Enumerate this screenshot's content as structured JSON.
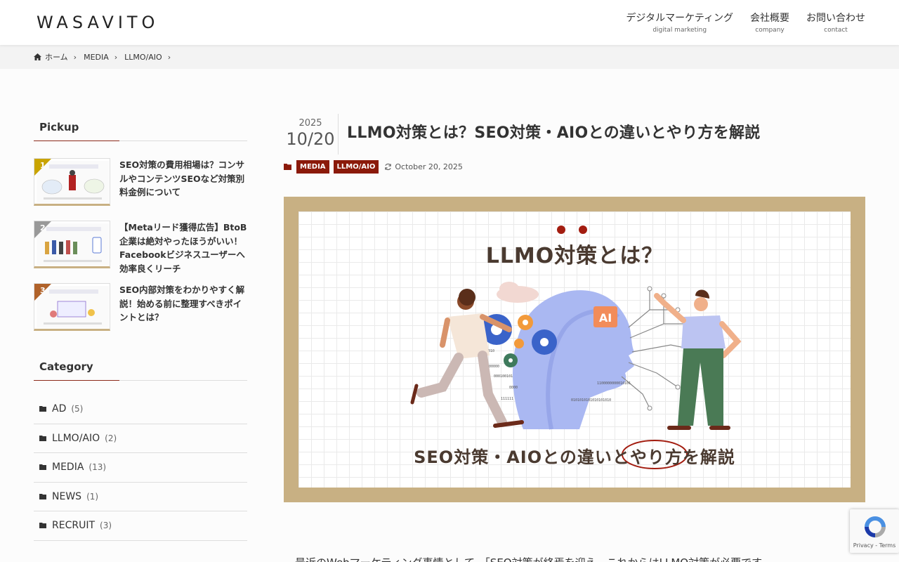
{
  "header": {
    "logo": "WASAVITO",
    "nav": [
      {
        "jp": "デジタルマーケティング",
        "en": "digital marketing"
      },
      {
        "jp": "会社概要",
        "en": "company"
      },
      {
        "jp": "お問い合わせ",
        "en": "contact"
      }
    ]
  },
  "breadcrumb": [
    "ホーム",
    "MEDIA",
    "LLMO/AIO"
  ],
  "sidebar": {
    "pickup_title": "Pickup",
    "pickup": [
      {
        "rank": "1",
        "title": "SEO対策の費用相場は？コンサルやコンテンツSEOなど対策別料金例について"
      },
      {
        "rank": "2",
        "title": "【Metaリード獲得広告】BtoB企業は絶対やったほうがいい！Facebookビジネスユーザーへ効率良くリーチ"
      },
      {
        "rank": "3",
        "title": "SEO内部対策をわかりやすく解説！始める前に整理すべきポイントとは？"
      }
    ],
    "category_title": "Category",
    "categories": [
      {
        "name": "AD",
        "count": "(5)"
      },
      {
        "name": "LLMO/AIO",
        "count": "(2)"
      },
      {
        "name": "MEDIA",
        "count": "(13)"
      },
      {
        "name": "NEWS",
        "count": "(1)"
      },
      {
        "name": "RECRUIT",
        "count": "(3)"
      }
    ]
  },
  "post": {
    "year": "2025",
    "month_day": "10/20",
    "title": "LLMO対策とは？SEO対策・AIOとの違いとやり方を解説",
    "tags": [
      "MEDIA",
      "LLMO/AIO"
    ],
    "updated": "October 20, 2025",
    "hero_title": "LLMO対策とは？",
    "hero_sub": "SEO対策・AIOとの違いとやり方を解説",
    "hero_badge": "AI",
    "body_start": "最近のWebマーケティング事情として、「SEO対策が終焉を迎え、これからはLLMO対策が必要です"
  },
  "recaptcha": {
    "links": "Privacy - Terms"
  },
  "colors": {
    "accent": "#8b1a0a",
    "hero_frame": "#c8b083",
    "tag_bg": "#8b1a0a"
  }
}
